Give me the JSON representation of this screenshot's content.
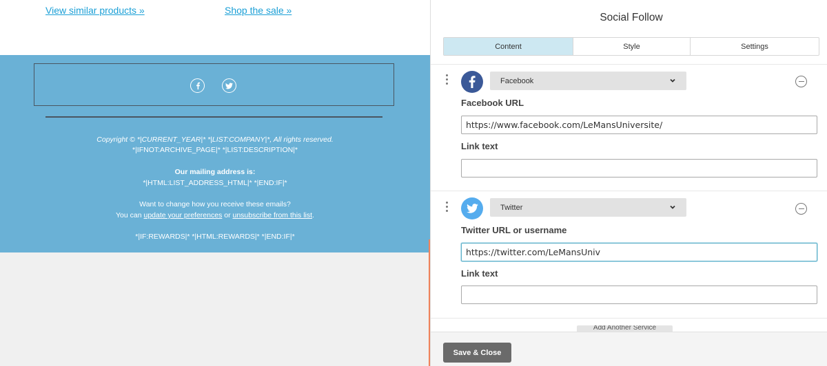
{
  "preview": {
    "links": {
      "similar": "View similar products »",
      "sale": "Shop the sale »"
    },
    "footer": {
      "copyright": "Copyright © *|CURRENT_YEAR|* *|LIST:COMPANY|*, All rights reserved.",
      "archive": "*|IFNOT:ARCHIVE_PAGE|* *|LIST:DESCRIPTION|*",
      "mailing_heading": "Our mailing address is:",
      "mailing_address": "*|HTML:LIST_ADDRESS_HTML|* *|END:IF|*",
      "change_text": "Want to change how you receive these emails?",
      "prefs_prefix": "You can ",
      "prefs_link": "update your preferences",
      "prefs_middle": " or ",
      "unsubscribe_link": "unsubscribe from this list",
      "prefs_suffix": ".",
      "rewards": "*|IF:REWARDS|* *|HTML:REWARDS|* *|END:IF|*"
    },
    "colors": {
      "footer_bg": "#6ab1d6",
      "link": "#1a9fd6"
    }
  },
  "panel": {
    "title": "Social Follow",
    "tabs": [
      {
        "label": "Content",
        "active": true
      },
      {
        "label": "Style",
        "active": false
      },
      {
        "label": "Settings",
        "active": false
      }
    ],
    "services": [
      {
        "icon": "facebook-icon",
        "color": "#3b5998",
        "service": "Facebook",
        "url_label": "Facebook URL",
        "url_value": "https://www.facebook.com/LeMansUniversite/",
        "link_text_label": "Link text",
        "link_text_value": ""
      },
      {
        "icon": "twitter-icon",
        "color": "#55acee",
        "service": "Twitter",
        "url_label": "Twitter URL or username",
        "url_value": "https://twitter.com/LeMansUniv",
        "link_text_label": "Link text",
        "link_text_value": ""
      }
    ],
    "add_service_label": "Add Another Service",
    "save_label": "Save & Close",
    "colors": {
      "active_tab": "#cde8f2",
      "accent": "#f0825a",
      "save_bg": "#6a6a6a"
    }
  }
}
